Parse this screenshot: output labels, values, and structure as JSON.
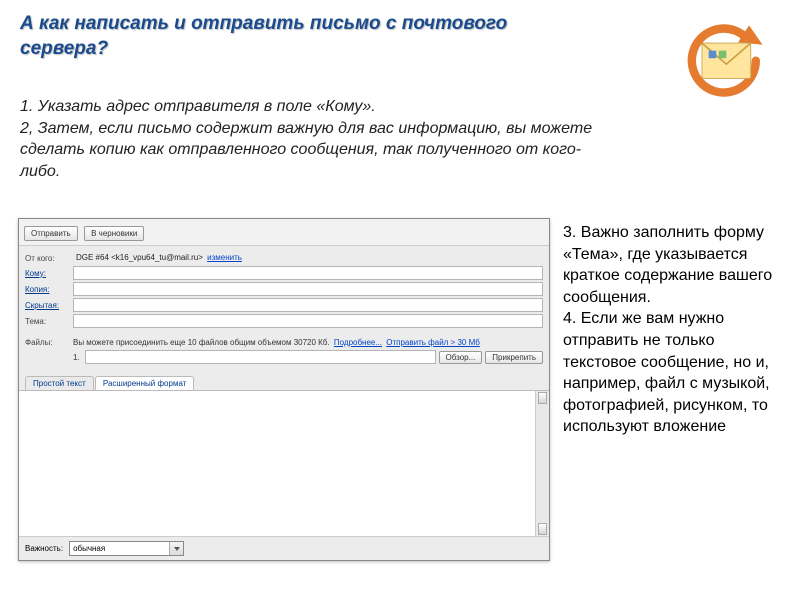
{
  "title": "А как написать и отправить письмо с почтового сервера?",
  "intro": "1. Указать адрес отправителя в поле «Кому».\n2, Затем, если письмо содержит важную для вас информацию, вы можете сделать копию как отправленного сообщения, так полученного от кого-либо.",
  "right": "3. Важно заполнить форму «Тема», где указывается краткое содержание вашего сообщения.\n4. Если же вам нужно отправить не только текстовое сообщение, но и, например, файл с музыкой, фотографией, рисунком, то используют вложение",
  "icon_name": "mail-refresh-icon",
  "compose": {
    "toolbar": {
      "send": "Отправить",
      "drafts": "В черновики"
    },
    "labels": {
      "from": "От кого:",
      "to": "Кому:",
      "cc": "Копия:",
      "bcc": "Скрытая:",
      "subject": "Тема:",
      "files": "Файлы:",
      "priority": "Важность:"
    },
    "from_value": "DGE #64 <k16_vpu64_tu@mail.ru>",
    "from_change": "изменить",
    "files_hint": "Вы можете присоединить еще 10 файлов общим объемом 30720 Кб.",
    "files_link_more": "Подробнее...",
    "files_link_big": "Отправить файл > 30 Мб",
    "file_index": "1.",
    "browse": "Обзор...",
    "attach": "Прикрепить",
    "tabs": {
      "plain": "Простой текст",
      "rich": "Расширенный формат"
    },
    "priority_value": "обычная"
  }
}
